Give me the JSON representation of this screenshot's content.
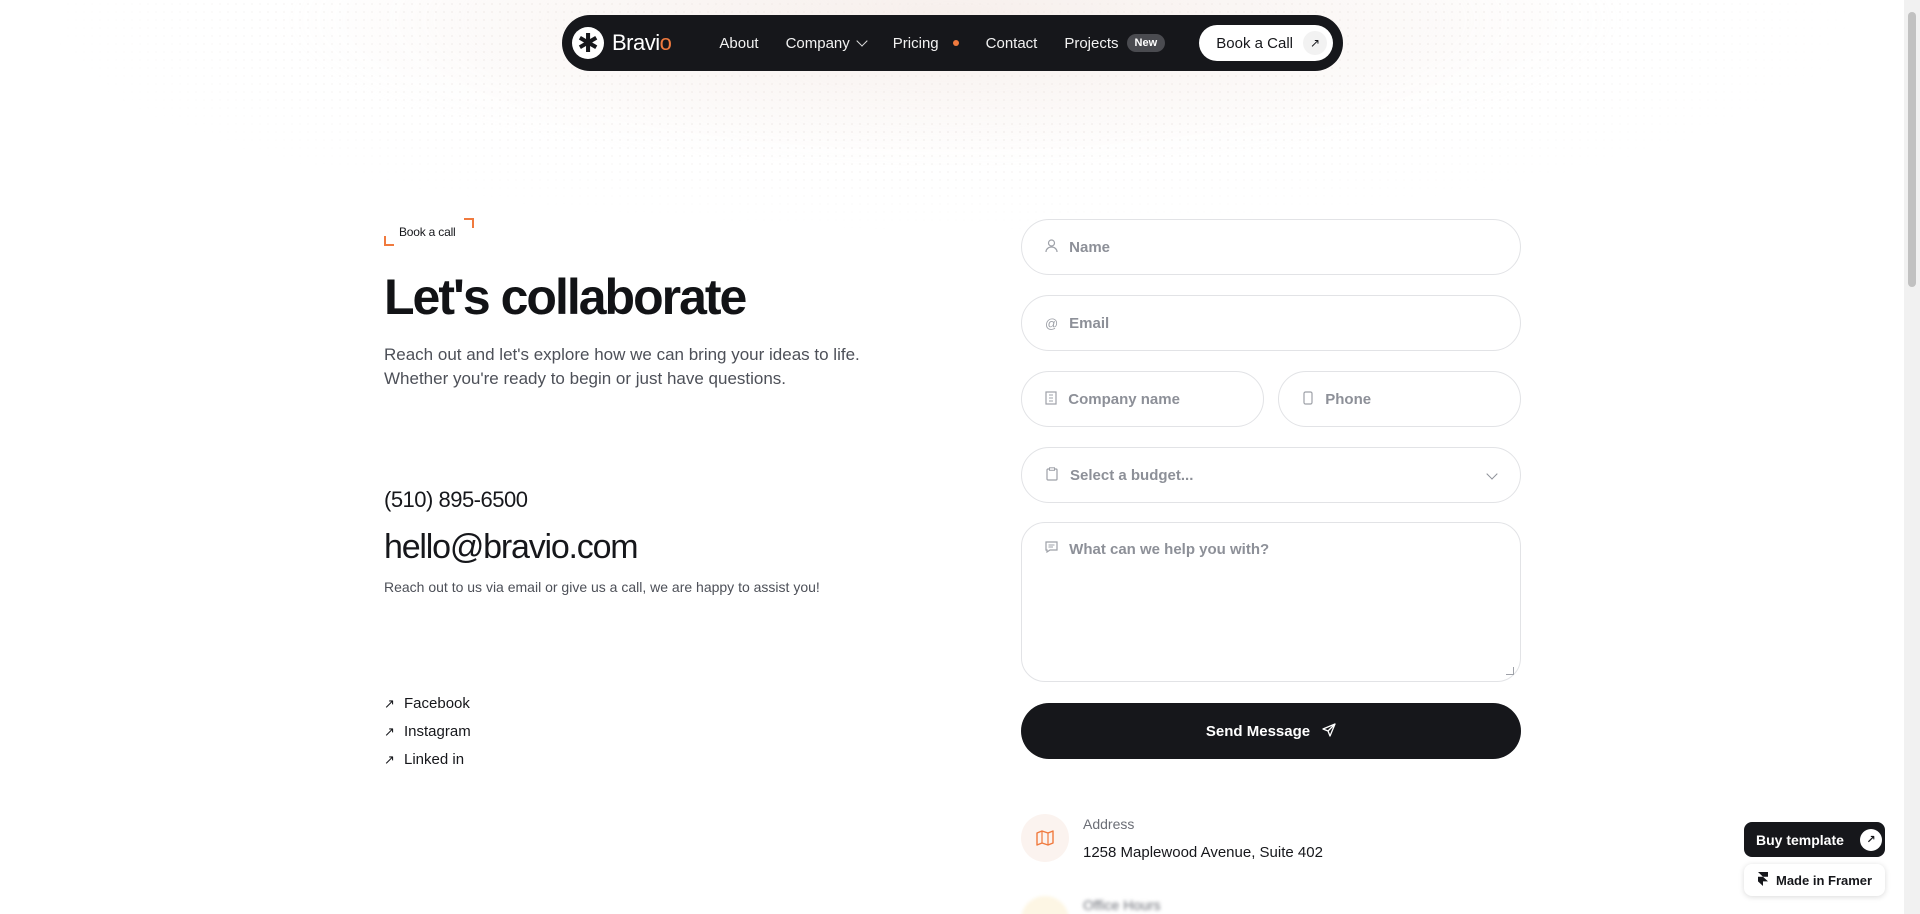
{
  "nav": {
    "brand": "Bravi",
    "brand_accent": "o",
    "logo_glyph": "✱",
    "links": {
      "about": "About",
      "company": "Company",
      "pricing": "Pricing",
      "contact": "Contact",
      "projects": "Projects"
    },
    "projects_badge": "New",
    "cta_label": "Book a Call",
    "cta_icon": "arrow-up-right-icon"
  },
  "hero": {
    "eyebrow": "Book a call",
    "headline": "Let's collaborate",
    "intro": "Reach out and let's explore how we can bring your ideas to life. Whether you're ready to begin or just have questions."
  },
  "contact": {
    "phone": "(510) 895-6500",
    "email": "hello@bravio.com",
    "assist": "Reach out to us via email or give us a call, we are happy to assist you!"
  },
  "socials": [
    "Facebook",
    "Instagram",
    "Linked in"
  ],
  "form": {
    "name_placeholder": "Name",
    "email_placeholder": "Email",
    "company_placeholder": "Company name",
    "phone_placeholder": "Phone",
    "budget_placeholder": "Select a budget...",
    "message_placeholder": "What can we help you with?",
    "submit_label": "Send Message"
  },
  "info": {
    "address_label": "Address",
    "address_value": "1258 Maplewood Avenue, Suite 402",
    "hours_label": "Office Hours"
  },
  "widgets": {
    "buy_label": "Buy template",
    "framer_label": "Made in Framer"
  },
  "colors": {
    "accent": "#f07a3e",
    "dark": "#16171b"
  }
}
